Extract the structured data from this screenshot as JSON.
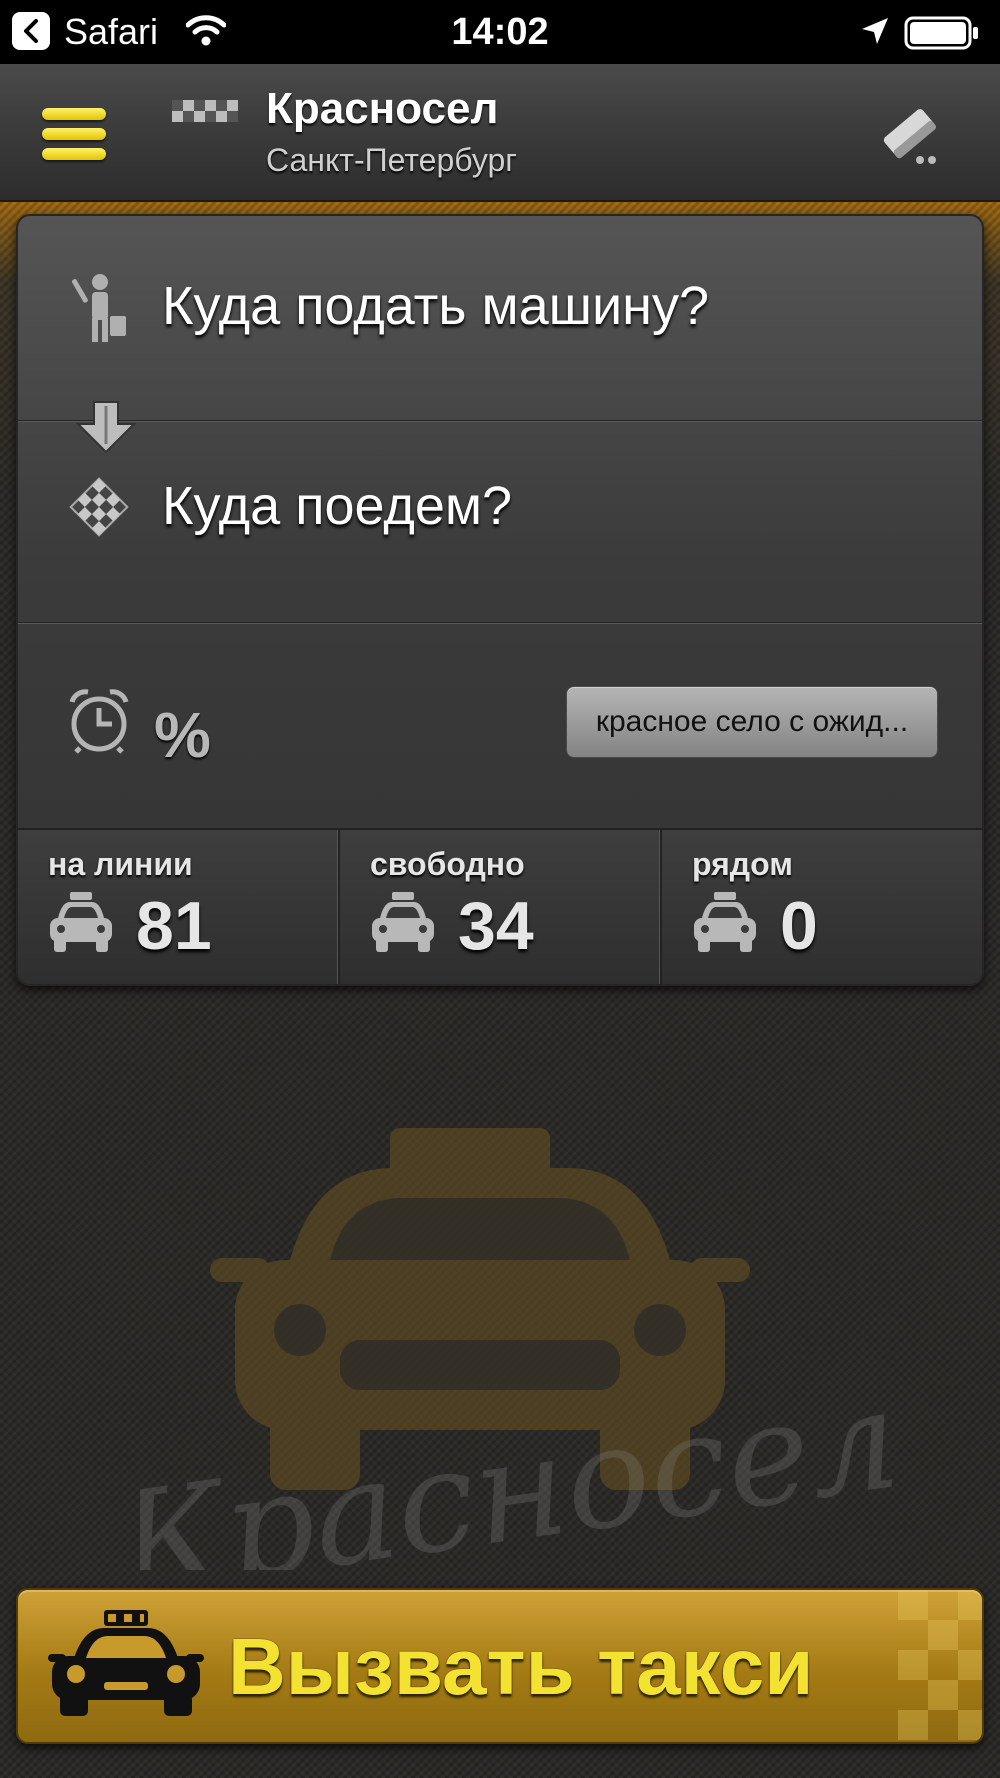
{
  "status_bar": {
    "back_app": "Safari",
    "time": "14:02",
    "icons": [
      "back-icon",
      "wifi-icon",
      "location-arrow-icon",
      "battery-icon"
    ]
  },
  "header": {
    "title": "Красносел",
    "subtitle": "Санкт-Петербург",
    "icons": [
      "menu-icon",
      "taxi-checker-icon",
      "eraser-icon"
    ]
  },
  "order": {
    "pickup_placeholder": "Куда подать машину?",
    "destination_placeholder": "Куда поедем?",
    "discount_symbol": "%",
    "tariff_button": "красное село с ожид..."
  },
  "stats": [
    {
      "label": "на линии",
      "value": "81"
    },
    {
      "label": "свободно",
      "value": "34"
    },
    {
      "label": "рядом",
      "value": "0"
    }
  ],
  "watermark_text": "Красносел",
  "call_button": {
    "label": "Вызвать такси"
  },
  "colors": {
    "accent_yellow": "#f3e231",
    "call_button": "#b8881e",
    "panel": "#444444",
    "header": "#3a3a3a"
  }
}
